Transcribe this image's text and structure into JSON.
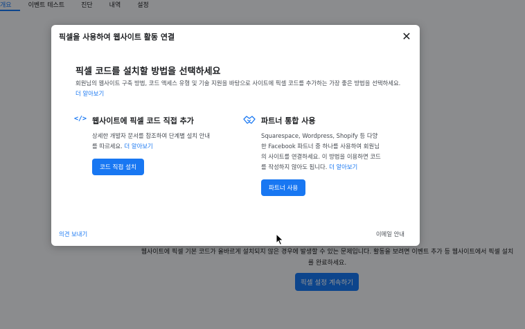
{
  "tabs": [
    {
      "label": "개요",
      "active": true
    },
    {
      "label": "이벤트 테스트"
    },
    {
      "label": "진단"
    },
    {
      "label": "내역"
    },
    {
      "label": "설정"
    }
  ],
  "background": {
    "message": "웹사이트에 픽셀 기본 코드가 올바르게 설치되지 않은 경우에 발생할 수 있는 문제입니다. 활동을 보려면 이벤트 추가 등 웹사이트에서 픽셀 설치를 완료하세요.",
    "continue_button": "픽셀 설정 계속하기"
  },
  "modal": {
    "title": "픽셀을 사용하여 웹사이트 활동 연결",
    "heading": "픽셀 코드를 설치할 방법을 선택하세요",
    "description": "회원님의 웹사이트 구축 방법, 코드 액세스 유형 및 기술 지원을 바탕으로 사이트에 픽셀 코드를 추가하는 가장 좋은 방법을 선택하세요.",
    "learn_more": "더 알아보기",
    "manual": {
      "icon": "</>",
      "title": "웹사이트에 픽셀 코드 직접 추가",
      "text": "상세한 개발자 문서를 참조하여 단계별 설치 안내를 따르세요.",
      "learn_more": "더 알아보기",
      "button": "코드 직접 설치"
    },
    "partner": {
      "icon": "handshake-icon",
      "title": "파트너 통합 사용",
      "text": "Squarespace, Wordpress, Shopify 등 다양한 Facebook 파트너 중 하나를 사용하여 회원님의 사이트를 연결하세요. 이 방법을 이용하면 코드를 작성하지 않아도 됩니다.",
      "learn_more": "더 알아보기",
      "button": "파트너 사용"
    },
    "feedback": "의견 보내기",
    "email_help": "이메일 안내"
  }
}
